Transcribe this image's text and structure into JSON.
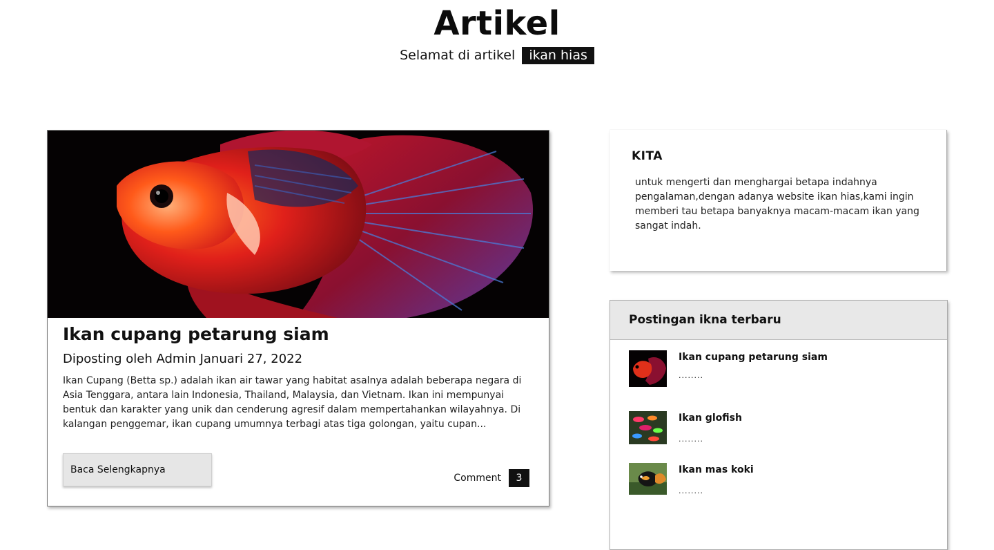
{
  "header": {
    "title": "Artikel",
    "subtitle_prefix": "Selamat di artikel",
    "subtitle_highlight": "ikan hias"
  },
  "article": {
    "image_alt": "betta fish",
    "title": "Ikan cupang petarung siam",
    "meta": "Diposting oleh Admin Januari 27, 2022",
    "body": "Ikan Cupang (Betta sp.) adalah ikan air tawar yang habitat asalnya adalah beberapa negara di Asia Tenggara, antara lain Indonesia, Thailand, Malaysia, dan Vietnam. Ikan ini mempunyai bentuk dan karakter yang unik dan cenderung agresif dalam mempertahankan wilayahnya. Di kalangan penggemar, ikan cupang umumnya terbagi atas tiga golongan, yaitu cupan...",
    "read_more_label": "Baca Selengkapnya",
    "comment_label": "Comment",
    "comment_count": "3"
  },
  "about": {
    "title": "KITA",
    "text": "untuk mengerti dan menghargai betapa indahnya pengalaman,dengan adanya website ikan hias,kami ingin memberi tau betapa banyaknya macam-macam ikan yang sangat indah."
  },
  "recent": {
    "title": "Postingan ikna terbaru",
    "posts": [
      {
        "name": "Ikan cupang petarung siam",
        "excerpt": "........"
      },
      {
        "name": "Ikan glofish",
        "excerpt": "........"
      },
      {
        "name": "Ikan mas koki",
        "excerpt": "........"
      }
    ]
  },
  "colors": {
    "highlight_bg": "#111111",
    "card_header_bg": "#e8e8e8",
    "button_bg": "#e6e6e6"
  }
}
